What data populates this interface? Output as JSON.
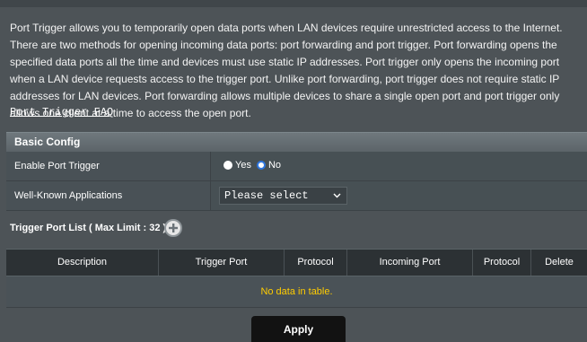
{
  "intro": {
    "text": "Port Trigger allows you to temporarily open data ports when LAN devices require unrestricted access to the Internet. There are two methods for opening incoming data ports: port forwarding and port trigger. Port forwarding opens the specified data ports all the time and devices must use static IP addresses. Port trigger only opens the incoming port when a LAN device requests access to the trigger port. Unlike port forwarding, port trigger does not require static IP addresses for LAN devices. Port forwarding allows multiple devices to share a single open port and port trigger only allows one client at a time to access the open port.",
    "faq_link": "Port Trigger FAQ"
  },
  "basic_config": {
    "title": "Basic Config",
    "enable": {
      "label": "Enable Port Trigger",
      "yes": "Yes",
      "no": "No",
      "selected": "No"
    },
    "apps": {
      "label": "Well-Known Applications",
      "selected": "Please select"
    }
  },
  "trigger_list": {
    "title": "Trigger Port List ( Max Limit : 32 )",
    "columns": [
      "Description",
      "Trigger Port",
      "Protocol",
      "Incoming Port",
      "Protocol",
      "Delete"
    ],
    "empty_message": "No data in table."
  },
  "apply_label": "Apply",
  "icons": {
    "add": "plus-circle-icon",
    "dropdown": "chevron-down-icon"
  },
  "colors": {
    "background": "#4d5357",
    "table_header": "#2c3134",
    "empty_text": "#ffcc00",
    "radio_selected": "#2d76e0",
    "apply_button": "#121212"
  }
}
